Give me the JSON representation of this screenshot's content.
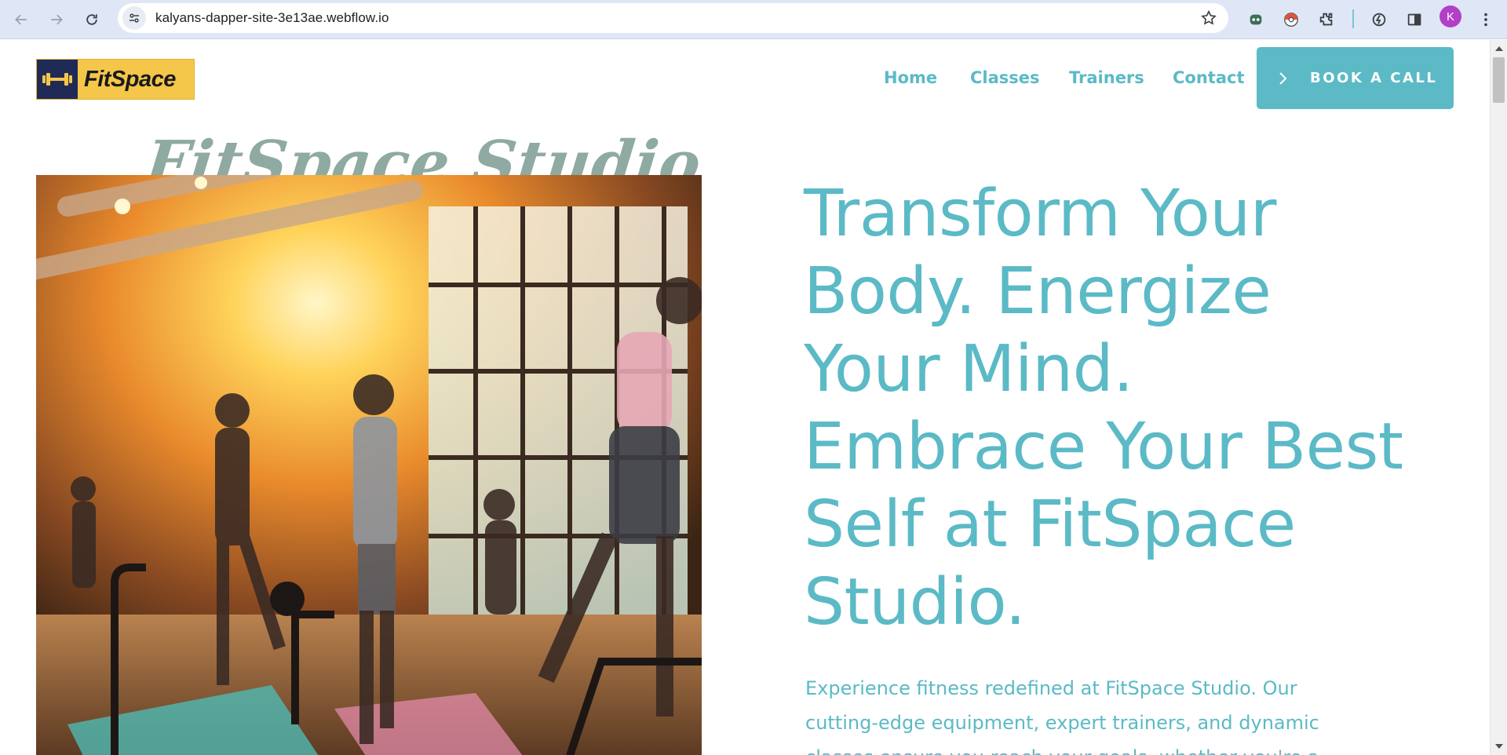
{
  "browser": {
    "url": "kalyans-dapper-site-3e13ae.webflow.io",
    "profile_initial": "K"
  },
  "nav": {
    "logo_text": "FitSpace",
    "links": [
      "Home",
      "Classes",
      "Trainers",
      "Contact"
    ],
    "cta_label": "BOOK A CALL"
  },
  "hero": {
    "studio_title": "FitSpace Studio",
    "heading_lines": [
      "Transform Your",
      "Body. Energize",
      "Your Mind.",
      "Embrace Your Best",
      "Self at FitSpace",
      "Studio."
    ],
    "paragraph_lines": [
      "Experience fitness redefined at FitSpace Studio. Our",
      "cutting-edge equipment, expert trainers, and dynamic",
      "classes ensure you reach your goals, whether you're a"
    ]
  },
  "colors": {
    "accent": "#5bbac6",
    "logo_bg": "#f4c64a",
    "logo_mark": "#1f2a57",
    "studio_title": "#8eaaa2"
  },
  "icons": {
    "back": "arrow-left-icon",
    "forward": "arrow-right-icon",
    "reload": "reload-icon",
    "site_info": "tune-icon",
    "bookmark": "star-icon",
    "extensions": [
      "robot-extension-icon",
      "pokeball-extension-icon",
      "puzzle-icon",
      "performance-icon",
      "sidebar-icon"
    ],
    "menu": "kebab-menu-icon"
  }
}
